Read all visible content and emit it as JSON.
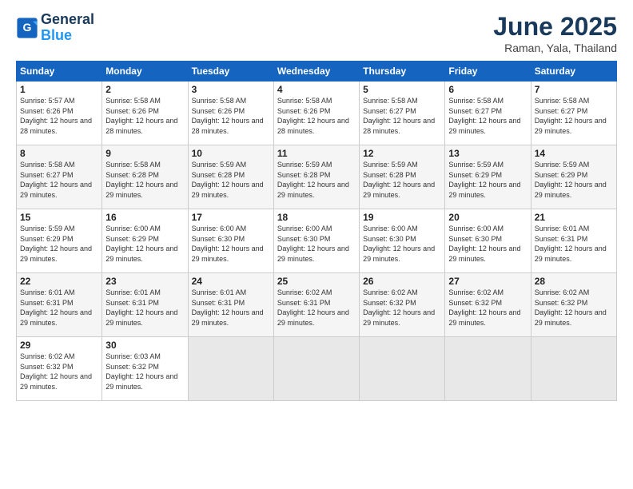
{
  "logo": {
    "line1": "General",
    "line2": "Blue"
  },
  "title": "June 2025",
  "subtitle": "Raman, Yala, Thailand",
  "days_header": [
    "Sunday",
    "Monday",
    "Tuesday",
    "Wednesday",
    "Thursday",
    "Friday",
    "Saturday"
  ],
  "weeks": [
    [
      {
        "day": "1",
        "sunrise": "5:57 AM",
        "sunset": "6:26 PM",
        "daylight": "12 hours and 28 minutes."
      },
      {
        "day": "2",
        "sunrise": "5:58 AM",
        "sunset": "6:26 PM",
        "daylight": "12 hours and 28 minutes."
      },
      {
        "day": "3",
        "sunrise": "5:58 AM",
        "sunset": "6:26 PM",
        "daylight": "12 hours and 28 minutes."
      },
      {
        "day": "4",
        "sunrise": "5:58 AM",
        "sunset": "6:26 PM",
        "daylight": "12 hours and 28 minutes."
      },
      {
        "day": "5",
        "sunrise": "5:58 AM",
        "sunset": "6:27 PM",
        "daylight": "12 hours and 28 minutes."
      },
      {
        "day": "6",
        "sunrise": "5:58 AM",
        "sunset": "6:27 PM",
        "daylight": "12 hours and 29 minutes."
      },
      {
        "day": "7",
        "sunrise": "5:58 AM",
        "sunset": "6:27 PM",
        "daylight": "12 hours and 29 minutes."
      }
    ],
    [
      {
        "day": "8",
        "sunrise": "5:58 AM",
        "sunset": "6:27 PM",
        "daylight": "12 hours and 29 minutes."
      },
      {
        "day": "9",
        "sunrise": "5:58 AM",
        "sunset": "6:28 PM",
        "daylight": "12 hours and 29 minutes."
      },
      {
        "day": "10",
        "sunrise": "5:59 AM",
        "sunset": "6:28 PM",
        "daylight": "12 hours and 29 minutes."
      },
      {
        "day": "11",
        "sunrise": "5:59 AM",
        "sunset": "6:28 PM",
        "daylight": "12 hours and 29 minutes."
      },
      {
        "day": "12",
        "sunrise": "5:59 AM",
        "sunset": "6:28 PM",
        "daylight": "12 hours and 29 minutes."
      },
      {
        "day": "13",
        "sunrise": "5:59 AM",
        "sunset": "6:29 PM",
        "daylight": "12 hours and 29 minutes."
      },
      {
        "day": "14",
        "sunrise": "5:59 AM",
        "sunset": "6:29 PM",
        "daylight": "12 hours and 29 minutes."
      }
    ],
    [
      {
        "day": "15",
        "sunrise": "5:59 AM",
        "sunset": "6:29 PM",
        "daylight": "12 hours and 29 minutes."
      },
      {
        "day": "16",
        "sunrise": "6:00 AM",
        "sunset": "6:29 PM",
        "daylight": "12 hours and 29 minutes."
      },
      {
        "day": "17",
        "sunrise": "6:00 AM",
        "sunset": "6:30 PM",
        "daylight": "12 hours and 29 minutes."
      },
      {
        "day": "18",
        "sunrise": "6:00 AM",
        "sunset": "6:30 PM",
        "daylight": "12 hours and 29 minutes."
      },
      {
        "day": "19",
        "sunrise": "6:00 AM",
        "sunset": "6:30 PM",
        "daylight": "12 hours and 29 minutes."
      },
      {
        "day": "20",
        "sunrise": "6:00 AM",
        "sunset": "6:30 PM",
        "daylight": "12 hours and 29 minutes."
      },
      {
        "day": "21",
        "sunrise": "6:01 AM",
        "sunset": "6:31 PM",
        "daylight": "12 hours and 29 minutes."
      }
    ],
    [
      {
        "day": "22",
        "sunrise": "6:01 AM",
        "sunset": "6:31 PM",
        "daylight": "12 hours and 29 minutes."
      },
      {
        "day": "23",
        "sunrise": "6:01 AM",
        "sunset": "6:31 PM",
        "daylight": "12 hours and 29 minutes."
      },
      {
        "day": "24",
        "sunrise": "6:01 AM",
        "sunset": "6:31 PM",
        "daylight": "12 hours and 29 minutes."
      },
      {
        "day": "25",
        "sunrise": "6:02 AM",
        "sunset": "6:31 PM",
        "daylight": "12 hours and 29 minutes."
      },
      {
        "day": "26",
        "sunrise": "6:02 AM",
        "sunset": "6:32 PM",
        "daylight": "12 hours and 29 minutes."
      },
      {
        "day": "27",
        "sunrise": "6:02 AM",
        "sunset": "6:32 PM",
        "daylight": "12 hours and 29 minutes."
      },
      {
        "day": "28",
        "sunrise": "6:02 AM",
        "sunset": "6:32 PM",
        "daylight": "12 hours and 29 minutes."
      }
    ],
    [
      {
        "day": "29",
        "sunrise": "6:02 AM",
        "sunset": "6:32 PM",
        "daylight": "12 hours and 29 minutes."
      },
      {
        "day": "30",
        "sunrise": "6:03 AM",
        "sunset": "6:32 PM",
        "daylight": "12 hours and 29 minutes."
      },
      null,
      null,
      null,
      null,
      null
    ]
  ]
}
